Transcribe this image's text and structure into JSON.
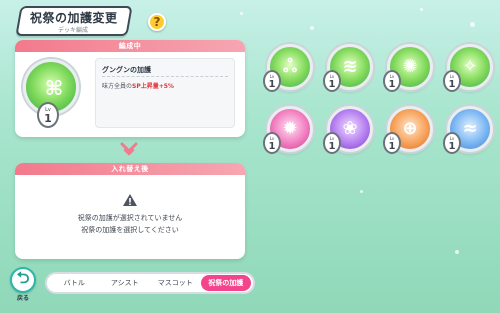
{
  "header": {
    "title": "祝祭の加護変更",
    "subtitle": "デッキ編成",
    "help_label": "?"
  },
  "equipped_panel": {
    "heading": "編成中",
    "medal": {
      "icon": "circular-knot-emblem-icon",
      "level_prefix": "Lv",
      "level": "1"
    },
    "name": "グングンの加護",
    "effect_prefix": "味方全員の",
    "effect_highlight": "SP上昇量+5%"
  },
  "swap_panel": {
    "heading": "入れ替え後",
    "empty_line1": "祝祭の加護が選択されていません",
    "empty_line2": "祝祭の加護を選択してください"
  },
  "medals": [
    {
      "name": "medal-green-beads",
      "icon": "beads-icon",
      "glyph": "ஃ",
      "level_prefix": "Lv",
      "level": "1"
    },
    {
      "name": "medal-green-wind",
      "icon": "wind-streaks-icon",
      "glyph": "≋",
      "level_prefix": "Lv",
      "level": "1"
    },
    {
      "name": "medal-green-swirl",
      "icon": "swirl-icon",
      "glyph": "✺",
      "level_prefix": "Lv",
      "level": "1"
    },
    {
      "name": "medal-green-arrow",
      "icon": "arrow-burst-icon",
      "glyph": "✧",
      "level_prefix": "Lv",
      "level": "1"
    },
    {
      "name": "medal-pink-burst",
      "icon": "starburst-icon",
      "glyph": "✹",
      "level_prefix": "Lv",
      "level": "1"
    },
    {
      "name": "medal-purple-rose",
      "icon": "rose-icon",
      "glyph": "❀",
      "level_prefix": "Lv",
      "level": "1"
    },
    {
      "name": "medal-orange-target",
      "icon": "target-icon",
      "glyph": "⊕",
      "level_prefix": "Lv",
      "level": "1"
    },
    {
      "name": "medal-blue-wave",
      "icon": "wave-icon",
      "glyph": "≈",
      "level_prefix": "Lv",
      "level": "1"
    }
  ],
  "bottom": {
    "back_label": "戻る",
    "tabs": [
      "バトル",
      "アシスト",
      "マスコット",
      "祝祭の加護"
    ],
    "active_tab": "祝祭の加護"
  },
  "colors": {
    "accent_pink": "#f2458b",
    "panel_header": "#f27a8c",
    "highlight_red": "#e5323e",
    "back_teal": "#2db6a8"
  }
}
